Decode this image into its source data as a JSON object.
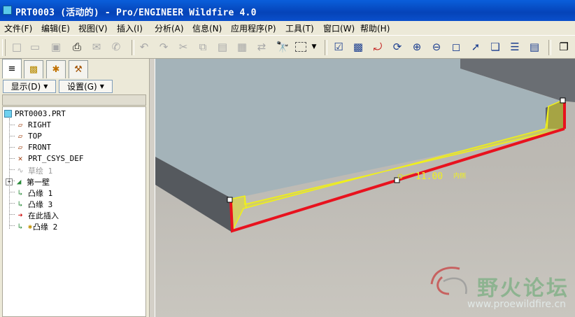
{
  "window": {
    "title": "PRT0003 (活动的) - Pro/ENGINEER Wildfire 4.0"
  },
  "menu": [
    {
      "label": "文件(F)"
    },
    {
      "label": "编辑(E)"
    },
    {
      "label": "视图(V)"
    },
    {
      "label": "插入(I)"
    },
    {
      "label": "分析(A)"
    },
    {
      "label": "信息(N)"
    },
    {
      "label": "应用程序(P)"
    },
    {
      "label": "工具(T)"
    },
    {
      "label": "窗口(W)"
    },
    {
      "label": "帮助(H)"
    }
  ],
  "toolbar": {
    "icons": [
      "new-file-icon",
      "open-file-icon",
      "save-icon",
      "print-icon",
      "email-icon",
      "send-icon",
      "undo-icon",
      "redo-icon",
      "cut-icon",
      "copy-icon",
      "paste-icon",
      "paste-special-icon",
      "regenerate-icon",
      "find-icon",
      "select-box-icon",
      "dropdown-icon",
      "model-tree-toggle-icon",
      "repaint-icon",
      "spin-center-icon",
      "orient-mode-icon",
      "zoom-in-icon",
      "zoom-out-icon",
      "refit-icon",
      "reorient-icon",
      "saved-views-icon",
      "layers-icon",
      "view-manager-icon",
      "hidden-line-icon"
    ]
  },
  "panel": {
    "tabs": [
      "model-tree-tab",
      "folder-browser-tab",
      "favorites-tab",
      "connections-tab"
    ],
    "display_button": "显示(D)",
    "settings_button": "设置(G)",
    "tree": [
      {
        "label": "PRT0003.PRT",
        "icon": "part-icon",
        "level": 0
      },
      {
        "label": "RIGHT",
        "icon": "datum-plane-icon",
        "level": 1
      },
      {
        "label": "TOP",
        "icon": "datum-plane-icon",
        "level": 1
      },
      {
        "label": "FRONT",
        "icon": "datum-plane-icon",
        "level": 1
      },
      {
        "label": "PRT_CSYS_DEF",
        "icon": "csys-icon",
        "level": 1
      },
      {
        "label": "草绘 1",
        "icon": "sketch-icon",
        "level": 1,
        "dim": true
      },
      {
        "label": "第一壁",
        "icon": "first-wall-icon",
        "level": 1,
        "expandable": true
      },
      {
        "label": "凸缘 1",
        "icon": "flange-icon",
        "level": 1
      },
      {
        "label": "凸缘 3",
        "icon": "flange-icon",
        "level": 1
      },
      {
        "label": "在此插入",
        "icon": "insert-here-arrow-icon",
        "level": 1
      },
      {
        "label": "凸缘 2",
        "icon": "flange-icon",
        "level": 1
      }
    ]
  },
  "viewport": {
    "dimension_text": "11.00",
    "dimension_note": "内侧",
    "watermark_title": "野火论坛",
    "watermark_url": "www.proewildfire.cn"
  },
  "colors": {
    "title_bar": "#0543b8",
    "highlight_edge": "#e8121e",
    "preview_yellow": "#f0f01a",
    "part_top": "#a6b4ba",
    "part_side": "#5d6166"
  }
}
